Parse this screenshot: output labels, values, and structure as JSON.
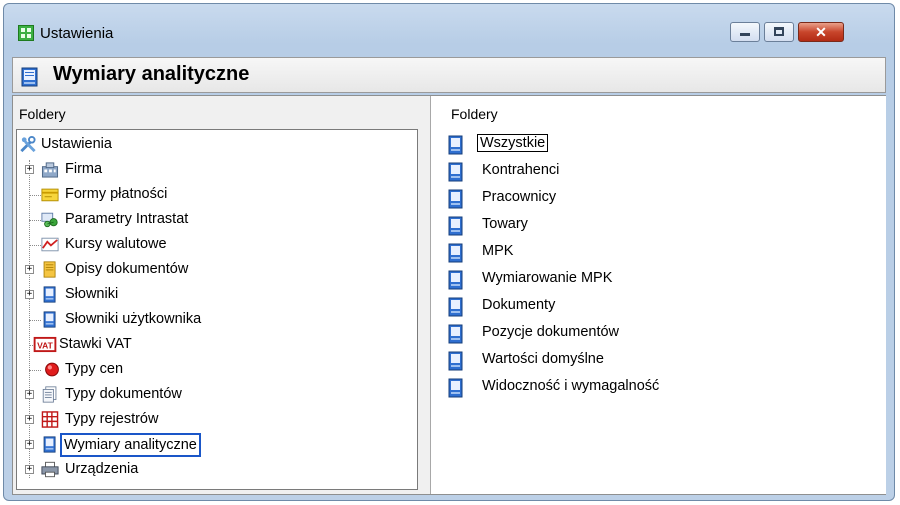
{
  "window": {
    "title": "Ustawienia"
  },
  "header": {
    "title": "Wymiary analityczne"
  },
  "left_panel": {
    "label": "Foldery",
    "root": "Ustawienia",
    "items": [
      {
        "label": "Firma",
        "icon": "building-icon",
        "expandable": true
      },
      {
        "label": "Formy płatności",
        "icon": "wallet-icon",
        "expandable": false
      },
      {
        "label": "Parametry Intrastat",
        "icon": "network-icon",
        "expandable": false
      },
      {
        "label": "Kursy walutowe",
        "icon": "chart-icon",
        "expandable": false
      },
      {
        "label": "Opisy dokumentów",
        "icon": "document-icon",
        "expandable": true
      },
      {
        "label": "Słowniki",
        "icon": "book-icon",
        "expandable": true
      },
      {
        "label": "Słowniki użytkownika",
        "icon": "book-icon",
        "expandable": false
      },
      {
        "label": "Stawki VAT",
        "icon": "vat-icon",
        "expandable": false
      },
      {
        "label": "Typy cen",
        "icon": "red-dot-icon",
        "expandable": false
      },
      {
        "label": "Typy dokumentów",
        "icon": "documents-icon",
        "expandable": true
      },
      {
        "label": "Typy rejestrów",
        "icon": "grid-icon",
        "expandable": true
      },
      {
        "label": "Wymiary analityczne",
        "icon": "book-icon",
        "expandable": true,
        "selected": true
      },
      {
        "label": "Urządzenia",
        "icon": "printer-icon",
        "expandable": true
      }
    ],
    "vat_badge": "VAT"
  },
  "right_panel": {
    "label": "Foldery",
    "items": [
      {
        "label": "Wszystkie",
        "focused": true
      },
      {
        "label": "Kontrahenci"
      },
      {
        "label": "Pracownicy"
      },
      {
        "label": "Towary"
      },
      {
        "label": "MPK"
      },
      {
        "label": "Wymiarowanie MPK"
      },
      {
        "label": "Dokumenty"
      },
      {
        "label": "Pozycje dokumentów"
      },
      {
        "label": "Wartości domyślne"
      },
      {
        "label": "Widoczność i wymagalność"
      }
    ]
  },
  "colors": {
    "selection_border": "#1a56c8",
    "titlebar": "#bcd0e7",
    "close_button": "#c8452b"
  }
}
